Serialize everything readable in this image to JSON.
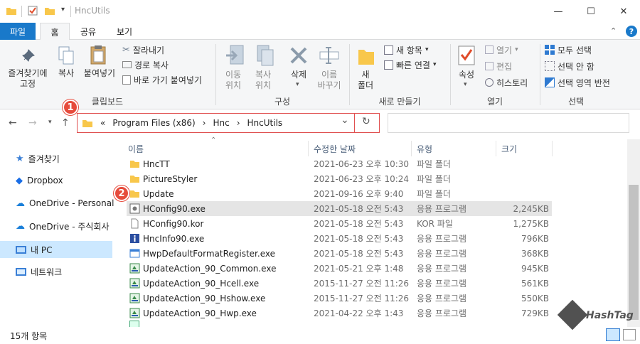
{
  "window": {
    "title": "HncUtils",
    "minimize": "—",
    "maximize": "☐",
    "close": "✕"
  },
  "ribbon_tabs": {
    "file": "파일",
    "home": "홈",
    "share": "공유",
    "view": "보기"
  },
  "clipboard": {
    "pin": "즐겨찾기에\n고정",
    "copy": "복사",
    "paste": "붙여넣기",
    "cut": "잘라내기",
    "copy_path": "경로 복사",
    "paste_shortcut": "바로 가기 붙여넣기",
    "group_label": "클립보드"
  },
  "organize": {
    "move_to": "이동\n위치",
    "copy_to": "복사\n위치",
    "delete": "삭제",
    "rename": "이름\n바꾸기",
    "group_label": "구성"
  },
  "new": {
    "new_folder": "새\n폴더",
    "new_item": "새 항목",
    "easy_access": "빠른 연결",
    "group_label": "새로 만들기"
  },
  "open": {
    "properties": "속성",
    "open": "열기",
    "edit": "편집",
    "history": "히스토리",
    "group_label": "열기"
  },
  "select": {
    "select_all": "모두 선택",
    "select_none": "선택 안 함",
    "invert": "선택 영역 반전",
    "group_label": "선택"
  },
  "address": {
    "chevrons": "«",
    "parts": [
      "Program Files (x86)",
      "Hnc",
      "HncUtils"
    ],
    "separator": "›",
    "dropdown": "⌄",
    "refresh": "↻"
  },
  "sidebar": {
    "items": [
      {
        "label": "즐겨찾기"
      },
      {
        "label": "Dropbox"
      },
      {
        "label": "OneDrive - Personal"
      },
      {
        "label": "OneDrive - 주식회사"
      },
      {
        "label": "내 PC"
      },
      {
        "label": "네트워크"
      }
    ]
  },
  "columns": {
    "name": "이름",
    "date": "수정한 날짜",
    "type": "유형",
    "size": "크기"
  },
  "files": [
    {
      "name": "HncTT",
      "date": "2021-06-23 오후 10:30",
      "type": "파일 폴더",
      "size": "",
      "icon": "folder"
    },
    {
      "name": "PictureStyler",
      "date": "2021-06-23 오후 10:24",
      "type": "파일 폴더",
      "size": "",
      "icon": "folder"
    },
    {
      "name": "Update",
      "date": "2021-09-16 오후 9:40",
      "type": "파일 폴더",
      "size": "",
      "icon": "folder"
    },
    {
      "name": "HConfig90.exe",
      "date": "2021-05-18 오전 5:43",
      "type": "응용 프로그램",
      "size": "2,245KB",
      "icon": "config"
    },
    {
      "name": "HConfig90.kor",
      "date": "2021-05-18 오전 5:43",
      "type": "KOR 파일",
      "size": "1,275KB",
      "icon": "doc"
    },
    {
      "name": "HncInfo90.exe",
      "date": "2021-05-18 오전 5:43",
      "type": "응용 프로그램",
      "size": "796KB",
      "icon": "info"
    },
    {
      "name": "HwpDefaultFormatRegister.exe",
      "date": "2021-05-18 오전 5:43",
      "type": "응용 프로그램",
      "size": "368KB",
      "icon": "app"
    },
    {
      "name": "UpdateAction_90_Common.exe",
      "date": "2021-05-21 오후 1:48",
      "type": "응용 프로그램",
      "size": "945KB",
      "icon": "update"
    },
    {
      "name": "UpdateAction_90_Hcell.exe",
      "date": "2015-11-27 오전 11:26",
      "type": "응용 프로그램",
      "size": "561KB",
      "icon": "update"
    },
    {
      "name": "UpdateAction_90_Hshow.exe",
      "date": "2015-11-27 오전 11:26",
      "type": "응용 프로그램",
      "size": "550KB",
      "icon": "update"
    },
    {
      "name": "UpdateAction_90_Hwp.exe",
      "date": "2021-04-22 오후 1:43",
      "type": "응용 프로그램",
      "size": "729KB",
      "icon": "update"
    }
  ],
  "status": {
    "count": "15개 항목"
  },
  "badges": [
    "1",
    "2"
  ],
  "watermark": "HashTag",
  "colors": {
    "accent": "#1979ca",
    "badge": "#e64b3c",
    "folder": "#f8c74b"
  }
}
